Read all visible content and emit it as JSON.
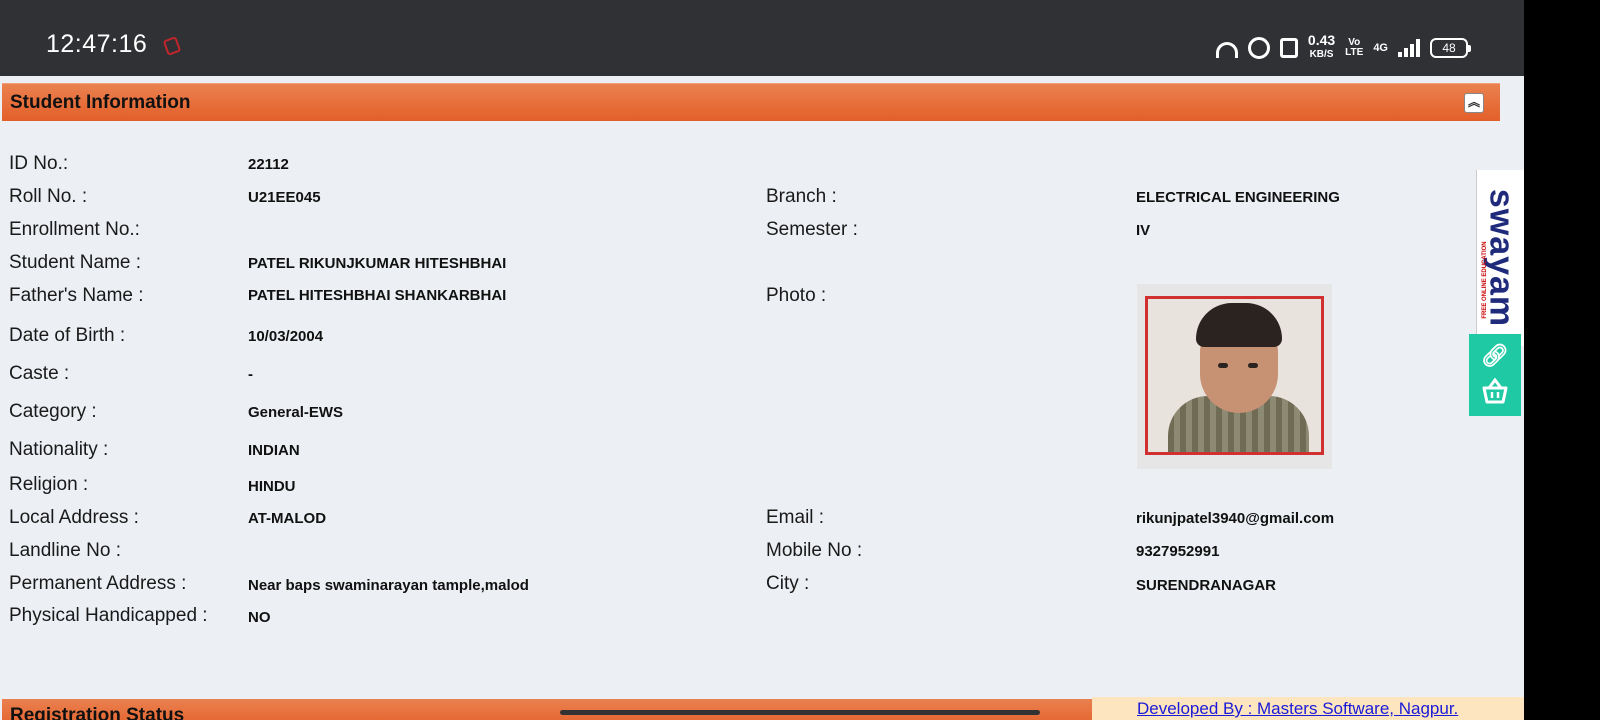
{
  "status_bar": {
    "time": "12:47:16",
    "net_speed_value": "0.43",
    "net_speed_unit": "KB/S",
    "volte_line1": "Vo",
    "volte_line2": "LTE",
    "network": "4G",
    "battery": "48"
  },
  "panel": {
    "title": "Student Information",
    "collapse_symbol": "︽"
  },
  "fields": {
    "id_no": {
      "label": "ID No.:",
      "value": "22112"
    },
    "roll_no": {
      "label": "Roll No. :",
      "value": "U21EE045"
    },
    "branch": {
      "label": "Branch :",
      "value": "ELECTRICAL ENGINEERING"
    },
    "enrollment_no": {
      "label": "Enrollment No.:",
      "value": ""
    },
    "semester": {
      "label": "Semester :",
      "value": "IV"
    },
    "student_name": {
      "label": "Student Name :",
      "value": "PATEL RIKUNJKUMAR HITESHBHAI"
    },
    "father_name": {
      "label": "Father's Name :",
      "value": "PATEL HITESHBHAI SHANKARBHAI"
    },
    "photo": {
      "label": "Photo :"
    },
    "dob": {
      "label": "Date of Birth :",
      "value": "10/03/2004"
    },
    "caste": {
      "label": "Caste :",
      "value": "-"
    },
    "category": {
      "label": "Category :",
      "value": "General-EWS"
    },
    "nationality": {
      "label": "Nationality :",
      "value": "INDIAN"
    },
    "religion": {
      "label": "Religion :",
      "value": "HINDU"
    },
    "local_address": {
      "label": "Local Address :",
      "value": "AT-MALOD"
    },
    "email": {
      "label": "Email :",
      "value": "rikunjpatel3940@gmail.com"
    },
    "landline": {
      "label": "Landline No :",
      "value": ""
    },
    "mobile": {
      "label": "Mobile No :",
      "value": "9327952991"
    },
    "permanent_address": {
      "label": "Permanent Address :",
      "value": "Near baps swaminarayan tample,malod"
    },
    "city": {
      "label": "City :",
      "value": "SURENDRANAGAR"
    },
    "physical_handicapped": {
      "label": "Physical Handicapped :",
      "value": "NO"
    }
  },
  "side_widget": {
    "logo_text": "swayam",
    "logo_sub": "FREE ONLINE EDUCATION",
    "link_icon": "link-icon",
    "basket_icon": "basket-icon"
  },
  "bottom": {
    "next_panel_title": "Registration Status",
    "footer_link": "Developed By : Masters Software, Nagpur."
  },
  "colors": {
    "panel_header": "#e3642f",
    "page_bg": "#eceff4",
    "status_bar": "#303135",
    "side_widget": "#1ec9a4",
    "footer_bg": "#fde5bf",
    "link": "#1a1ad8"
  }
}
